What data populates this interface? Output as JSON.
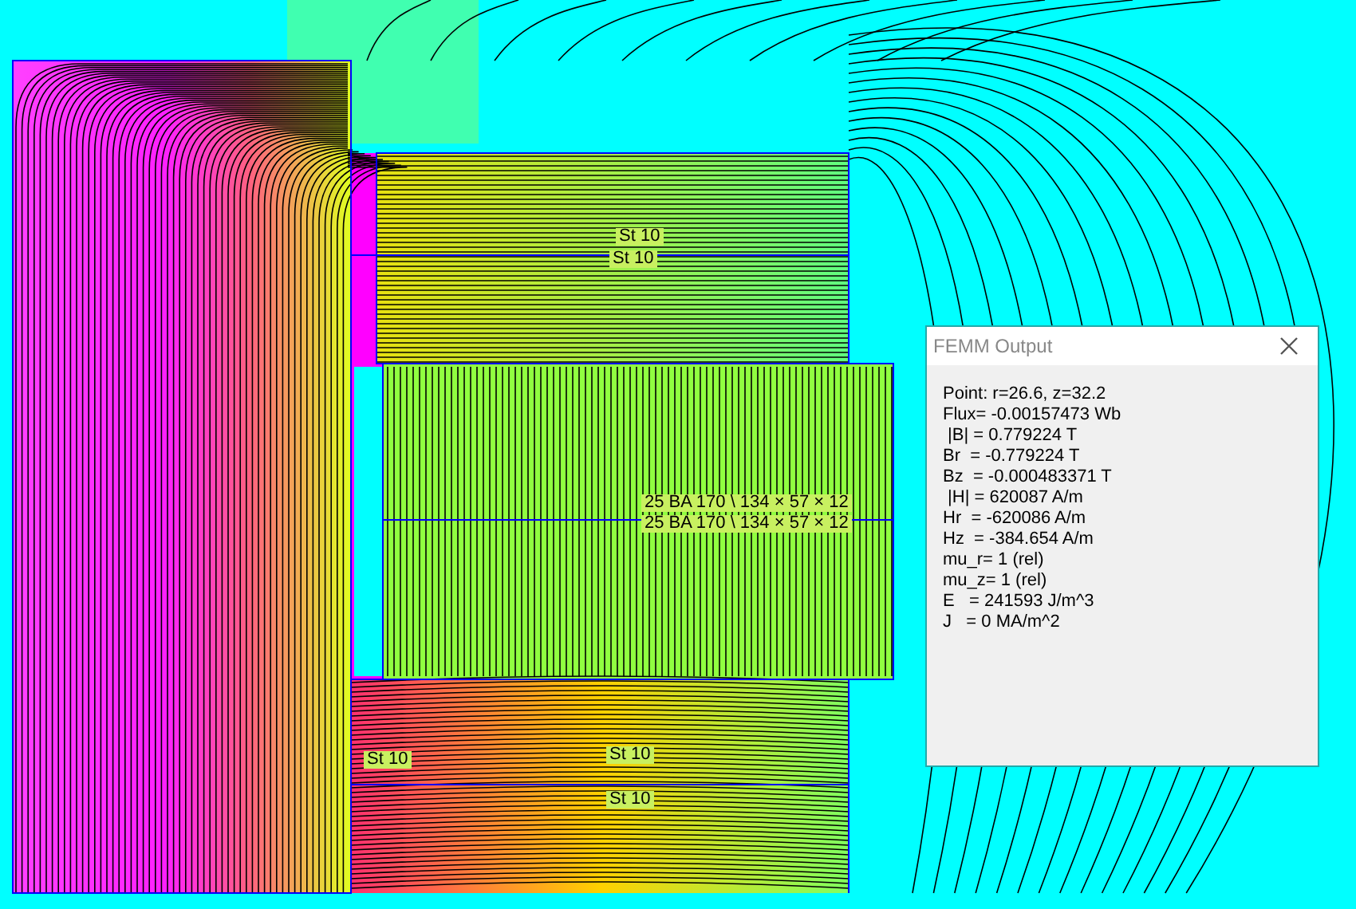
{
  "plot": {
    "labels": [
      {
        "text": "St 10"
      },
      {
        "text": "St 10"
      },
      {
        "text": "25 BA 170 \\ 134 × 57 × 12"
      },
      {
        "text": "25 BA 170 \\ 134 × 57 × 12"
      },
      {
        "text": "St 10"
      },
      {
        "text": "St 10"
      },
      {
        "text": "St 10"
      }
    ]
  },
  "output_window": {
    "title": "FEMM Output",
    "lines": [
      "Point: r=26.6, z=32.2",
      "Flux= -0.00157473 Wb",
      " |B| = 0.779224 T",
      "Br  = -0.779224 T",
      "Bz  = -0.000483371 T",
      " |H| = 620087 A/m",
      "Hr  = -620086 A/m",
      "Hz  = -384.654 A/m",
      "mu_r= 1 (rel)",
      "mu_z= 1 (rel)",
      "E   = 241593 J/m^3",
      "J   = 0 MA/m^2"
    ]
  }
}
